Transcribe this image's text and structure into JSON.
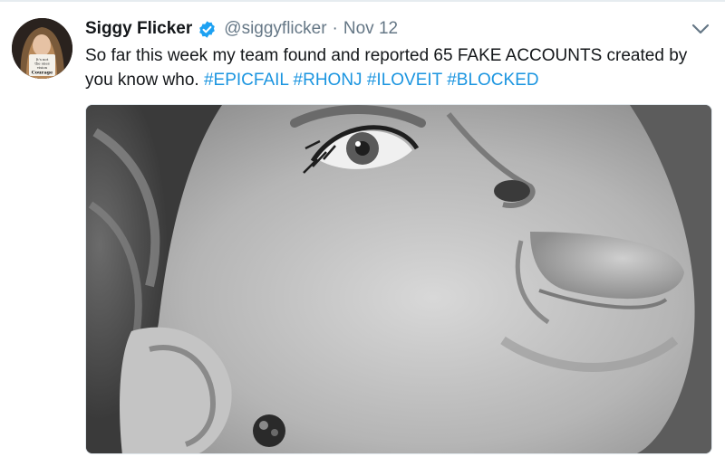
{
  "tweet": {
    "display_name": "Siggy Flicker",
    "handle": "@siggyflicker",
    "separator": "·",
    "date": "Nov 12",
    "text_segments": [
      {
        "text": "So far this week my team found and reported 65 FAKE ACCOUNTS created by you know who. ",
        "type": "plain"
      },
      {
        "text": "#EPICFAIL",
        "type": "hashtag"
      },
      {
        "text": " ",
        "type": "plain"
      },
      {
        "text": "#RHONJ",
        "type": "hashtag"
      },
      {
        "text": " ",
        "type": "plain"
      },
      {
        "text": "#ILOVEIT",
        "type": "hashtag"
      },
      {
        "text": " ",
        "type": "plain"
      },
      {
        "text": "#BLOCKED",
        "type": "hashtag"
      }
    ],
    "avatar_text": "It's not the gemes with the vision... Courage"
  },
  "icons": {
    "verified": "verified-badge-icon",
    "caret": "chevron-down-icon"
  },
  "colors": {
    "text": "#14171a",
    "secondary": "#657786",
    "link": "#1b95e0",
    "verified": "#1da1f2"
  }
}
